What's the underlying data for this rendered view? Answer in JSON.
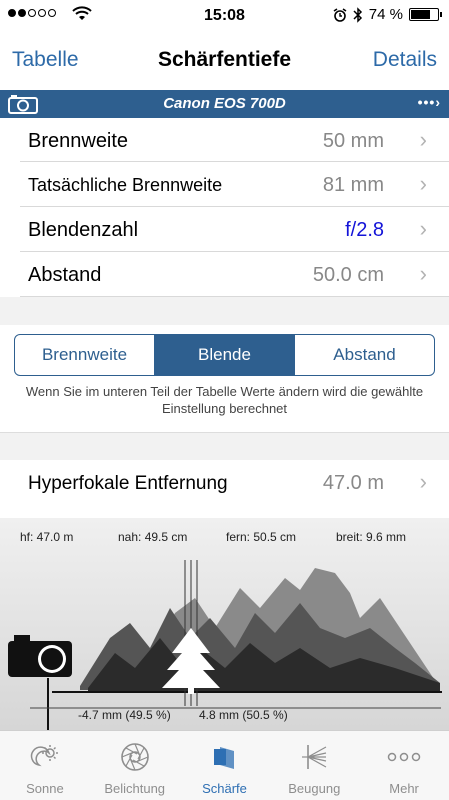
{
  "status": {
    "time": "15:08",
    "battery": "74 %",
    "battery_level": 0.74
  },
  "nav": {
    "back_label": "Tabelle",
    "title": "Schärfentiefe",
    "details_label": "Details"
  },
  "camera": {
    "name": "Canon EOS 700D",
    "more": "•••›"
  },
  "rows": [
    {
      "label": "Brennweite",
      "value": "50 mm"
    },
    {
      "label": "Tatsächliche Brennweite",
      "value": "81 mm"
    },
    {
      "label": "Blendenzahl",
      "value": "f/2.8"
    },
    {
      "label": "Abstand",
      "value": "50.0 cm"
    }
  ],
  "segment": {
    "options": [
      "Brennweite",
      "Blende",
      "Abstand"
    ],
    "selected": "Blende",
    "hint": "Wenn Sie im unteren Teil der Tabelle Werte ändern wird die gewählte Einstellung berechnet"
  },
  "hyperfocal": {
    "label": "Hyperfokale Entfernung",
    "value": "47.0 m"
  },
  "graph": {
    "hf": "hf: 47.0 m",
    "near": "nah: 49.5 cm",
    "far": "fern: 50.5 cm",
    "width": "breit: 9.6 mm",
    "minus": "-4.7 mm (49.5 %)",
    "plus": "4.8 mm (50.5 %)"
  },
  "tabs": [
    {
      "label": "Sonne",
      "icon": "sun-moon-icon"
    },
    {
      "label": "Belichtung",
      "icon": "aperture-icon"
    },
    {
      "label": "Schärfe",
      "icon": "depth-icon"
    },
    {
      "label": "Beugung",
      "icon": "diffraction-icon"
    },
    {
      "label": "Mehr",
      "icon": "more-icon"
    }
  ],
  "colors": {
    "accent": "#2e5f8f",
    "nav_text": "#2d6aa8",
    "value_blue": "#1414d8"
  }
}
